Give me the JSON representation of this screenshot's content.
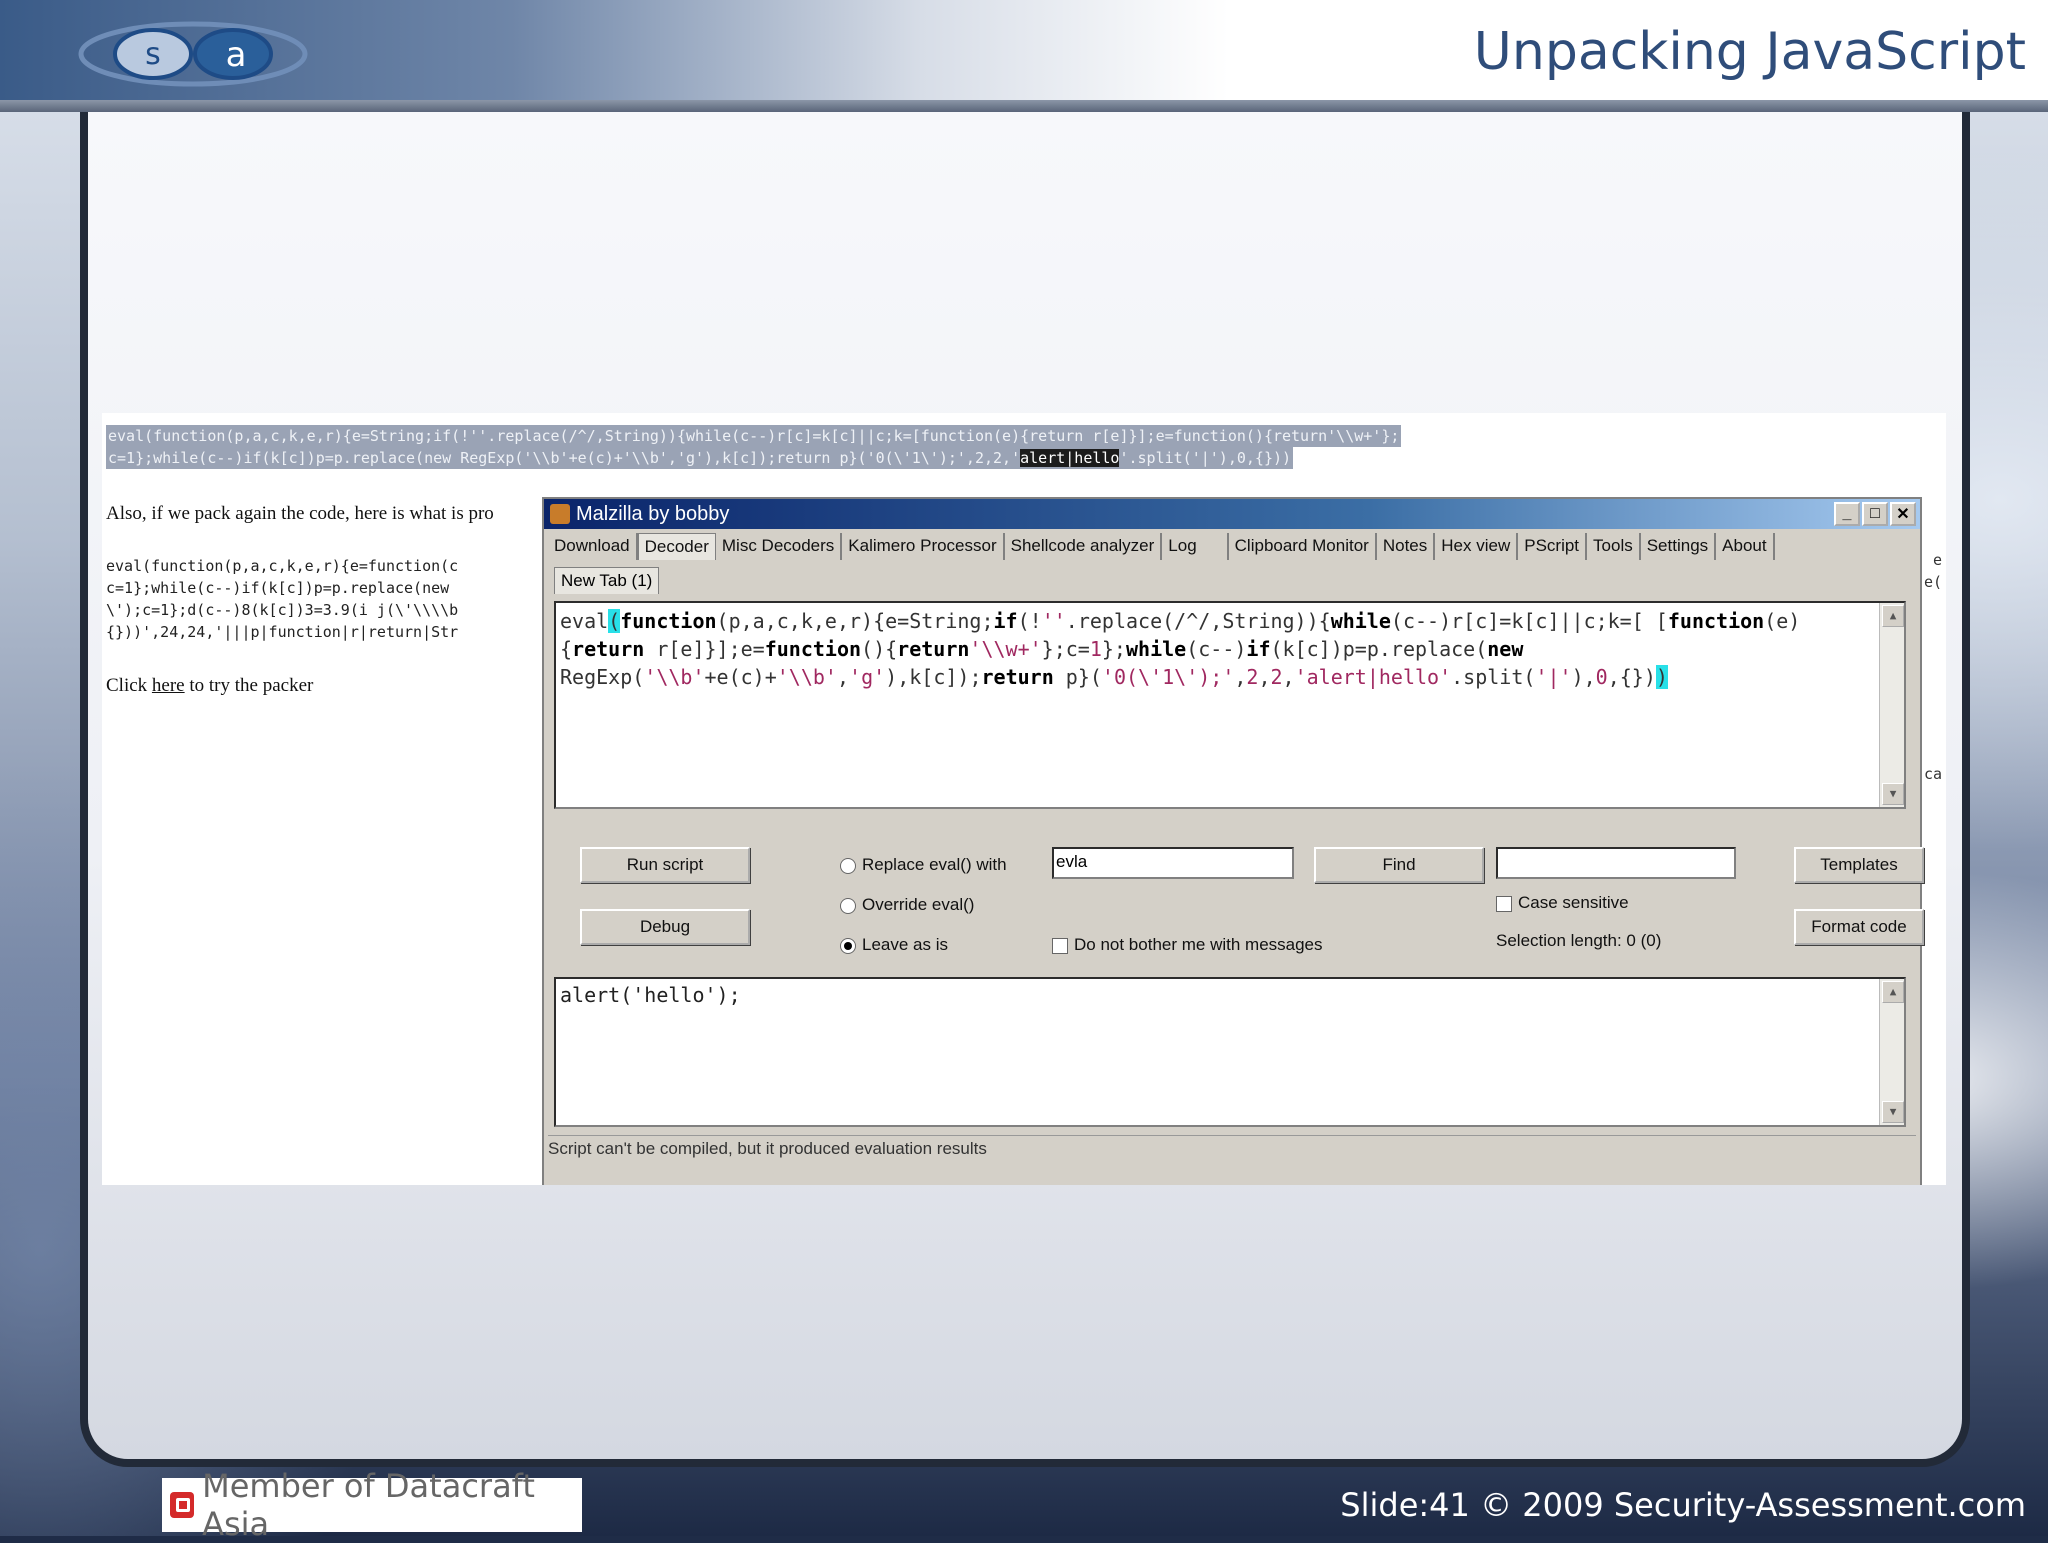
{
  "slide": {
    "title": "Unpacking JavaScript",
    "logo_text_left": "s",
    "logo_text_right": "a",
    "footer_left": "Member of Datacraft Asia",
    "footer_right": "Slide:41 © 2009 Security-Assessment.com"
  },
  "page": {
    "packed_line1": "eval(function(p,a,c,k,e,r){e=String;if(!''.replace(/^/,String)){while(c--)r[c]=k[c]||c;k=[function(e){return r[e]}];e=function(){return'\\\\w+'};",
    "packed_line2_a": "c=1};while(c--)if(k[c])p=p.replace(new RegExp('\\\\b'+e(c)+'\\\\b','g'),k[c]);return p}('0(\\'1\\');',2,2,'",
    "packed_line2_hl": "alert|hello",
    "packed_line2_b": "'.split('|'),0,{}))",
    "also_text": "Also, if we pack again the code, here is what is pro",
    "code2_l1": "eval(function(p,a,c,k,e,r){e=function(c",
    "code2_l2": "c=1};while(c--)if(k[c])p=p.replace(new",
    "code2_l3": "\\');c=1};d(c--)8(k[c])3=3.9(i j(\\'\\\\\\\\b",
    "code2_l4": "{}))',24,24,'|||p|function|r|return|Str",
    "click_prefix": "Click ",
    "click_link": "here",
    "click_suffix": " to try the packer",
    "right_edge_1": "e",
    "right_edge_2": "e(",
    "right_edge_3": "ca"
  },
  "window": {
    "title": "Malzilla by bobby",
    "minimize": "_",
    "maximize": "□",
    "close": "✕",
    "tabs": [
      "Download",
      "Decoder",
      "Misc Decoders",
      "Kalimero Processor",
      "Shellcode analyzer",
      "Log",
      "Clipboard Monitor",
      "Notes",
      "Hex view",
      "PScript",
      "Tools",
      "Settings",
      "About"
    ],
    "active_tab": "Decoder",
    "subtab": "New Tab (1)",
    "run_script": "Run script",
    "debug": "Debug",
    "radio_replace": "Replace eval() with",
    "radio_override": "Override eval()",
    "radio_leave": "Leave as is",
    "replace_value": "evla",
    "find": "Find",
    "find_value": "",
    "case_sensitive": "Case sensitive",
    "selection_length": "Selection length: 0 (0)",
    "do_not_bother": "Do not bother me with messages",
    "templates": "Templates",
    "format_code": "Format code",
    "output_text": "alert('hello');",
    "status": "Script can't be compiled, but it produced evaluation results"
  },
  "colors": {
    "title": "#2f4d7a",
    "titlebar_start": "#0a246a",
    "highlight_cyan": "#28e0e8"
  }
}
